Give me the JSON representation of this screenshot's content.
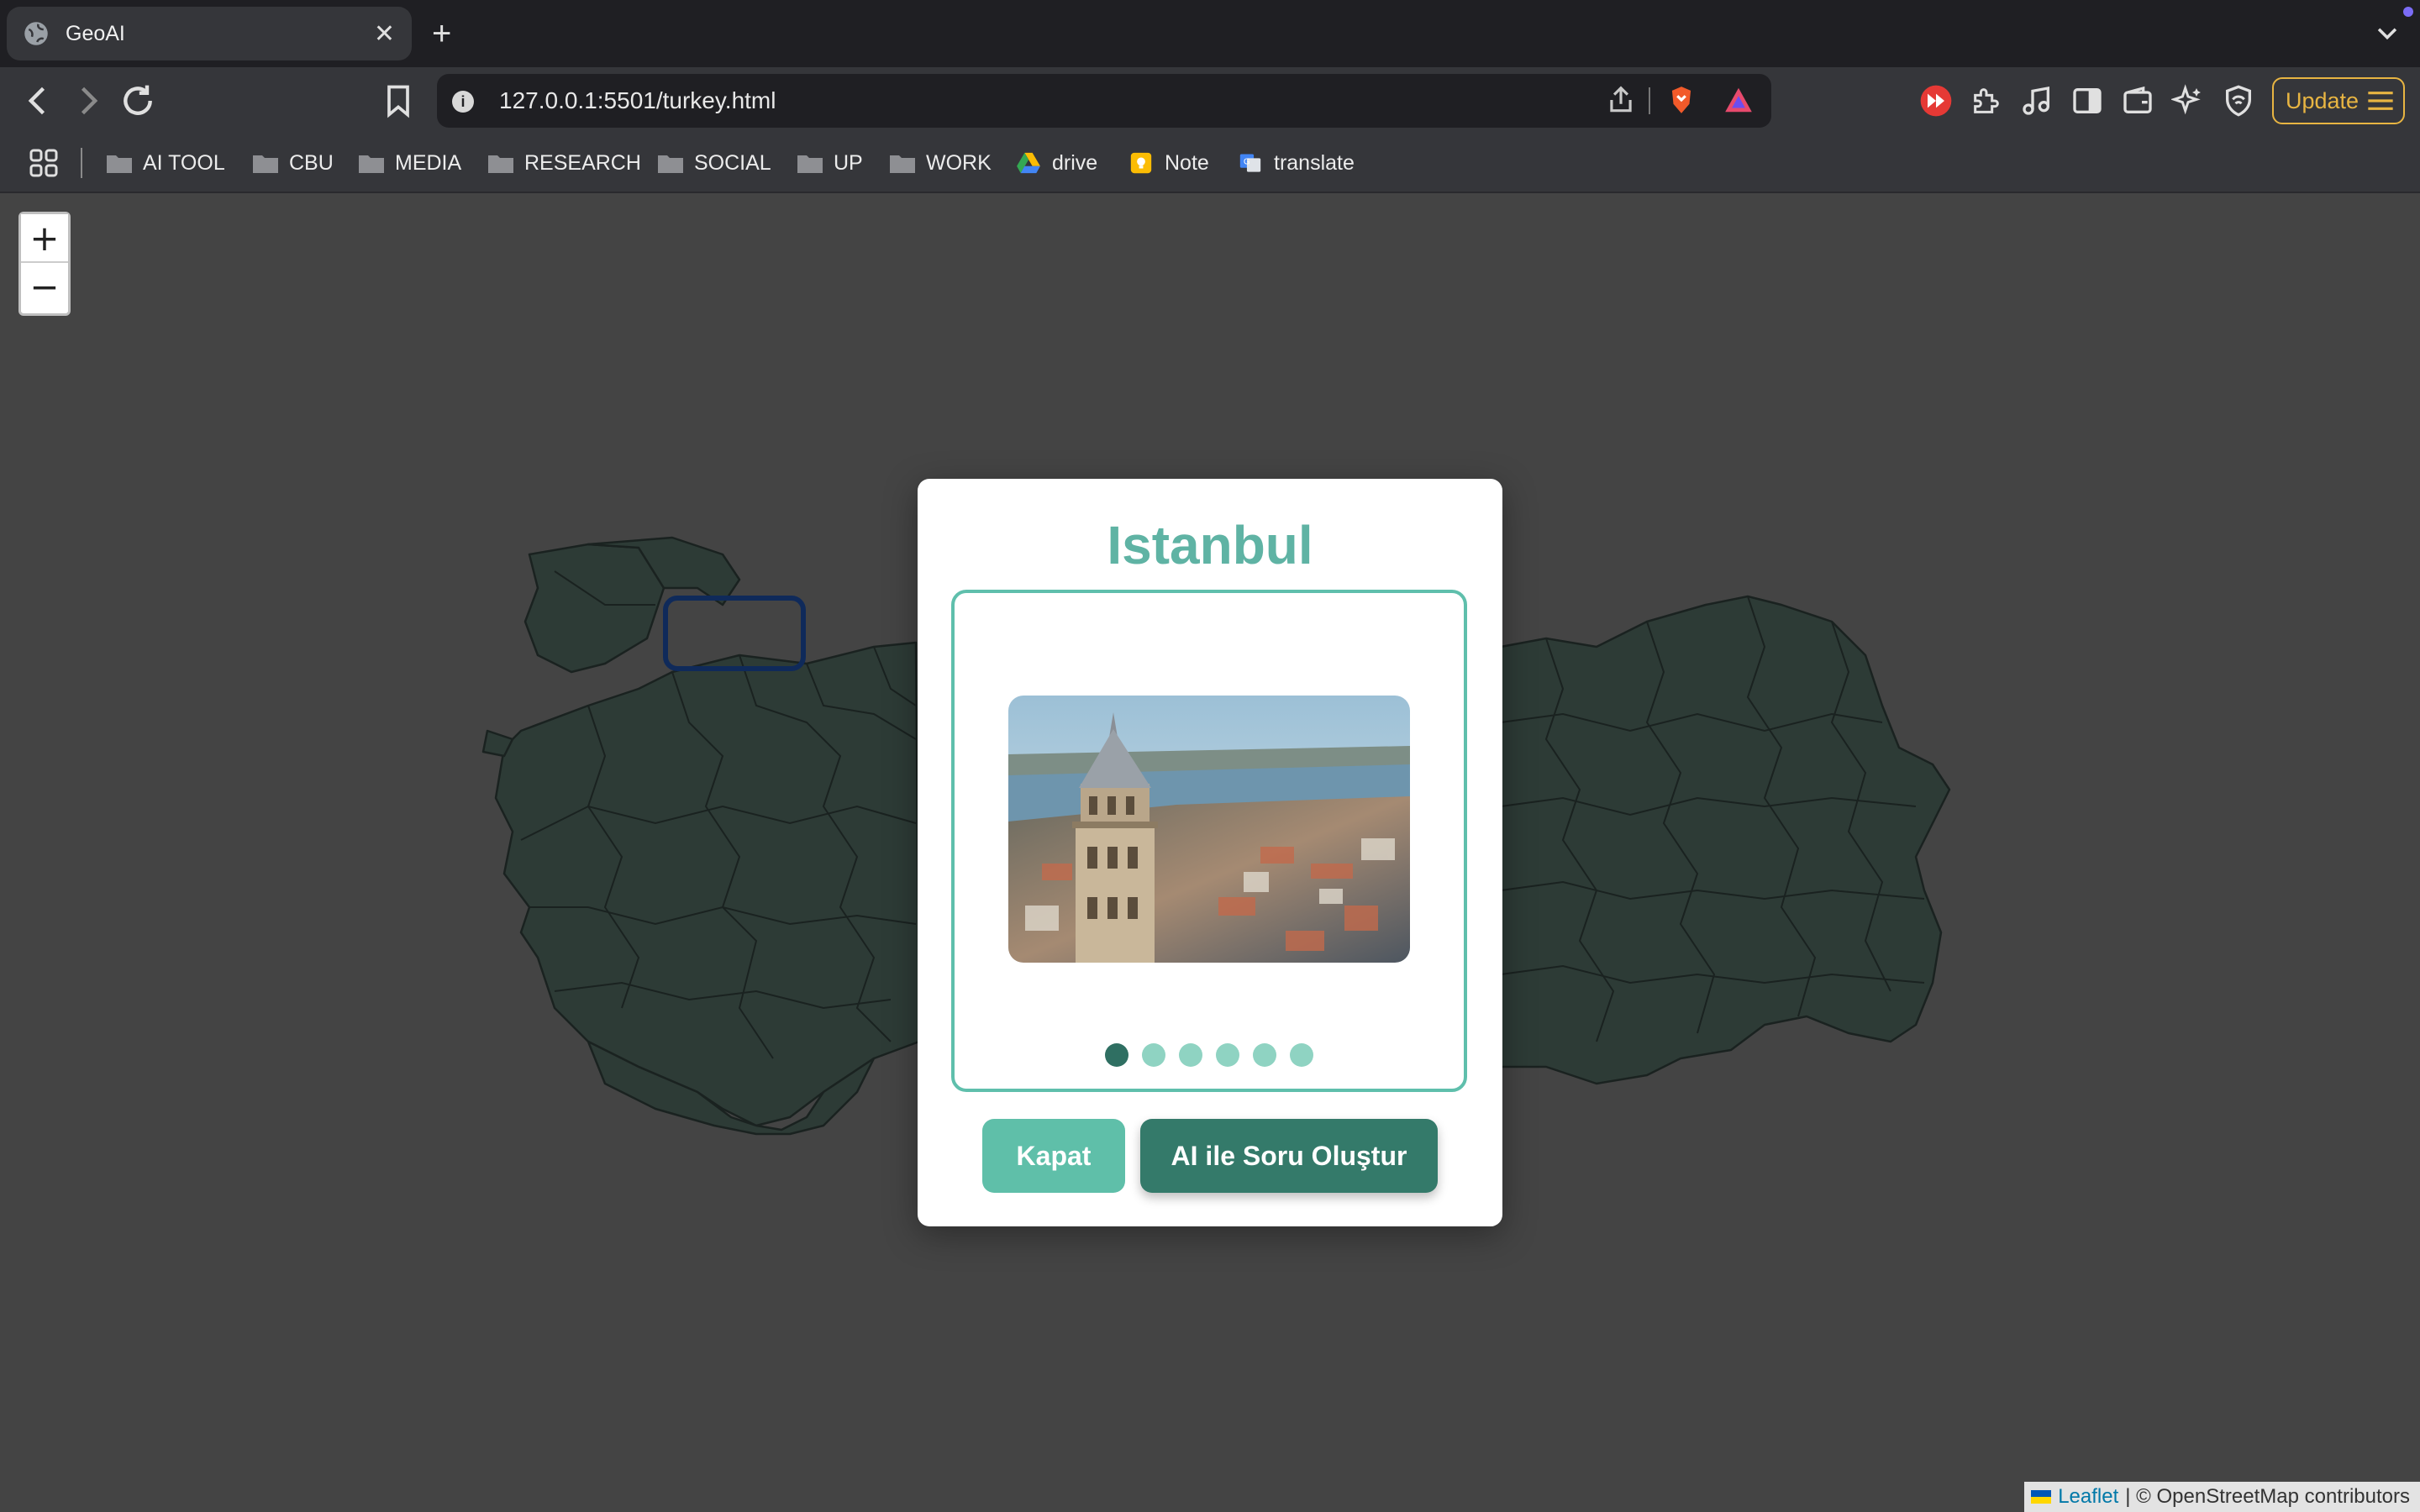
{
  "browser": {
    "tab_title": "GeoAI",
    "url": "127.0.0.1:5501/turkey.html",
    "update_label": "Update",
    "bookmarks": [
      {
        "label": "AI TOOL",
        "icon": "folder-icon"
      },
      {
        "label": "CBU",
        "icon": "folder-icon"
      },
      {
        "label": "MEDIA",
        "icon": "folder-icon"
      },
      {
        "label": "RESEARCH",
        "icon": "folder-icon"
      },
      {
        "label": "SOCIAL",
        "icon": "folder-icon"
      },
      {
        "label": "UP",
        "icon": "folder-icon"
      },
      {
        "label": "WORK",
        "icon": "folder-icon"
      },
      {
        "label": "drive",
        "icon": "google-drive-icon"
      },
      {
        "label": "Note",
        "icon": "note-icon"
      },
      {
        "label": "translate",
        "icon": "translate-icon"
      }
    ]
  },
  "map": {
    "zoom_in_label": "+",
    "zoom_out_label": "−",
    "attribution_leaflet": "Leaflet",
    "attribution_rest": "| © OpenStreetMap contributors",
    "province_fill": "#2d3b36",
    "highlight_color": "#0f2a5a"
  },
  "modal": {
    "title": "Istanbul",
    "carousel_total": 6,
    "carousel_active": 1,
    "close_label": "Kapat",
    "ai_label": "AI ile Soru Oluştur",
    "accent": "#5fbfac",
    "primary": "#347a6a"
  }
}
